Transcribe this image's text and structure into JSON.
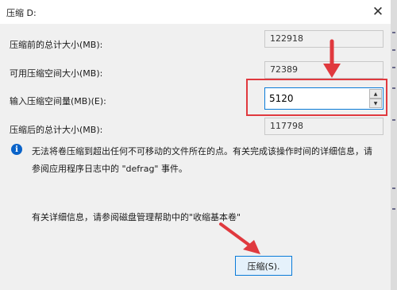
{
  "window": {
    "title": "压缩 D:",
    "close_icon": "close-icon"
  },
  "fields": [
    {
      "label": "压缩前的总计大小(MB):",
      "value": "122918"
    },
    {
      "label": "可用压缩空间大小(MB):",
      "value": "72389"
    },
    {
      "label": "输入压缩空间量(MB)(E):",
      "value": "5120"
    },
    {
      "label": "压缩后的总计大小(MB):",
      "value": "117798"
    }
  ],
  "info": {
    "icon": "info-icon",
    "line1": "无法将卷压缩到超出任何不可移动的文件所在的点。有关完成该操作时间的详细信息，请",
    "line2": "参阅应用程序日志中的 \"defrag\" 事件。"
  },
  "help_text": "有关详细信息，请参阅磁盘管理帮助中的\"收缩基本卷\"",
  "button": {
    "shrink_label": "压缩(S)."
  },
  "annotation_color": "#e0393e",
  "accent_color": "#0a7bd8"
}
